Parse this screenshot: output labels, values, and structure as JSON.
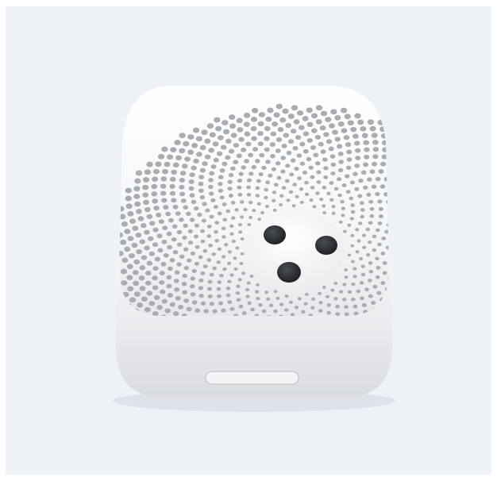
{
  "image": {
    "subject": "",
    "colors": {
      "background": "#eef1f6",
      "body": "#f6f7f9",
      "holes": "#a9adb2",
      "sensor_lens": "#26292d"
    }
  }
}
